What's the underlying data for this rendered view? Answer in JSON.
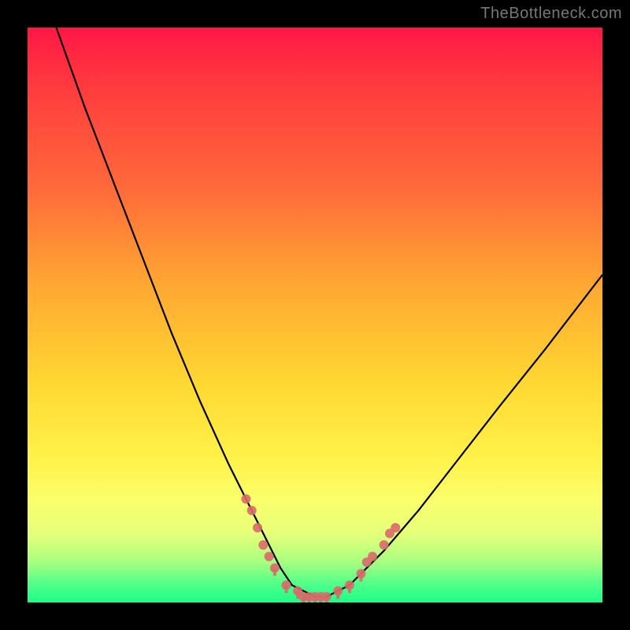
{
  "watermark": "TheBottleneck.com",
  "chart_data": {
    "type": "line",
    "title": "",
    "xlabel": "",
    "ylabel": "",
    "xlim": [
      0,
      100
    ],
    "ylim": [
      0,
      100
    ],
    "grid": false,
    "legend": false,
    "background_gradient": {
      "stops": [
        {
          "pos": 0,
          "color": "#ff1745"
        },
        {
          "pos": 28,
          "color": "#ff6a3a"
        },
        {
          "pos": 62,
          "color": "#ffd832"
        },
        {
          "pos": 82,
          "color": "#fbff6a"
        },
        {
          "pos": 100,
          "color": "#1cff88"
        }
      ]
    },
    "series": [
      {
        "name": "bottleneck-curve",
        "x": [
          5,
          10,
          15,
          20,
          25,
          30,
          35,
          38,
          40,
          42,
          44,
          46,
          48,
          50,
          52,
          54,
          56,
          58,
          62,
          68,
          75,
          82,
          90,
          100
        ],
        "y": [
          100,
          86,
          73,
          60,
          47,
          35,
          24,
          18,
          14,
          10,
          6,
          3,
          2,
          1,
          1,
          2,
          3,
          5,
          9,
          16,
          25,
          34,
          44,
          57
        ]
      }
    ],
    "markers": {
      "name": "highlight-dots",
      "color": "#d86a6a",
      "points": [
        {
          "x": 38,
          "y": 18
        },
        {
          "x": 39,
          "y": 16
        },
        {
          "x": 40,
          "y": 13
        },
        {
          "x": 41,
          "y": 10
        },
        {
          "x": 42,
          "y": 8
        },
        {
          "x": 43,
          "y": 6
        },
        {
          "x": 45,
          "y": 3
        },
        {
          "x": 47,
          "y": 2
        },
        {
          "x": 48,
          "y": 1
        },
        {
          "x": 49,
          "y": 1
        },
        {
          "x": 50,
          "y": 1
        },
        {
          "x": 51,
          "y": 1
        },
        {
          "x": 52,
          "y": 1
        },
        {
          "x": 54,
          "y": 2
        },
        {
          "x": 56,
          "y": 3
        },
        {
          "x": 58,
          "y": 5
        },
        {
          "x": 59,
          "y": 7
        },
        {
          "x": 60,
          "y": 8
        },
        {
          "x": 62,
          "y": 10
        },
        {
          "x": 63,
          "y": 12
        },
        {
          "x": 64,
          "y": 13
        }
      ]
    }
  }
}
